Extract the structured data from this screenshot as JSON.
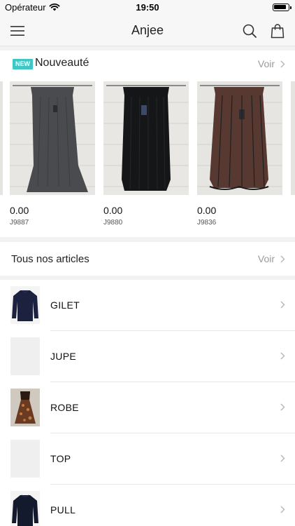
{
  "status_bar": {
    "carrier": "Opérateur",
    "time": "19:50",
    "battery": "full"
  },
  "header": {
    "title": "Anjee",
    "icons": [
      "menu-icon",
      "search-icon",
      "bag-icon"
    ]
  },
  "new_section": {
    "badge": "NEW",
    "title": "Nouveauté",
    "see_all": "Voir",
    "products": [
      {
        "price": "0.00",
        "ref": "J9887",
        "item_color": "#4a4b4e"
      },
      {
        "price": "0.00",
        "ref": "J9880",
        "item_color": "#151617"
      },
      {
        "price": "0.00",
        "ref": "J9836",
        "item_color": "#7a4a40"
      }
    ]
  },
  "all_articles": {
    "title": "Tous nos articles",
    "see_all": "Voir"
  },
  "categories": [
    {
      "label": "GILET",
      "thumb": "sweater"
    },
    {
      "label": "JUPE",
      "thumb": "none"
    },
    {
      "label": "ROBE",
      "thumb": "dress"
    },
    {
      "label": "TOP",
      "thumb": "none"
    },
    {
      "label": "PULL",
      "thumb": "sweater"
    }
  ],
  "colors": {
    "accent": "#3ec7c4",
    "background": "#ffffff",
    "bar_background": "#f7f7f7",
    "section_gap": "#f2f2f2",
    "muted_text": "#9a9a9a"
  }
}
